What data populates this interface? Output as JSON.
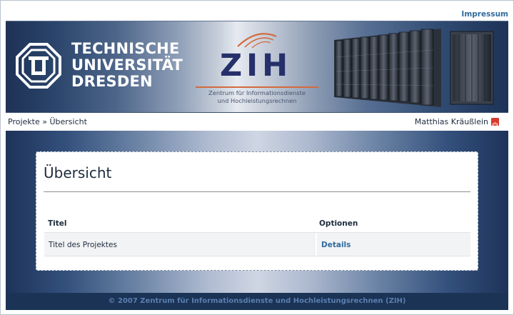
{
  "header": {
    "impressum_link": "Impressum"
  },
  "banner": {
    "tu_logo_lines": [
      "TECHNISCHE",
      "UNIVERSITÄT",
      "DRESDEN"
    ],
    "zih_title": "ZIH",
    "zih_subtitle_lines": [
      "Zentrum für Informationsdienste",
      "und Hochleistungsrechnen"
    ]
  },
  "breadcrumb": {
    "root": "Projekte",
    "separator": "»",
    "current": "Übersicht"
  },
  "user": {
    "name": "Matthias Kräußlein",
    "logout_icon": "power-icon"
  },
  "main": {
    "title": "Übersicht",
    "table": {
      "columns": [
        "Titel",
        "Optionen"
      ],
      "rows": [
        {
          "title": "Titel des Projektes",
          "option": "Details"
        }
      ]
    }
  },
  "footer": {
    "text": "© 2007 Zentrum für Informationsdienste und Hochleistungsrechnen (ZIH)"
  },
  "colors": {
    "link": "#2f6b9e",
    "footer_bg": "#1b3355",
    "zih_orange": "#d46a3d"
  }
}
